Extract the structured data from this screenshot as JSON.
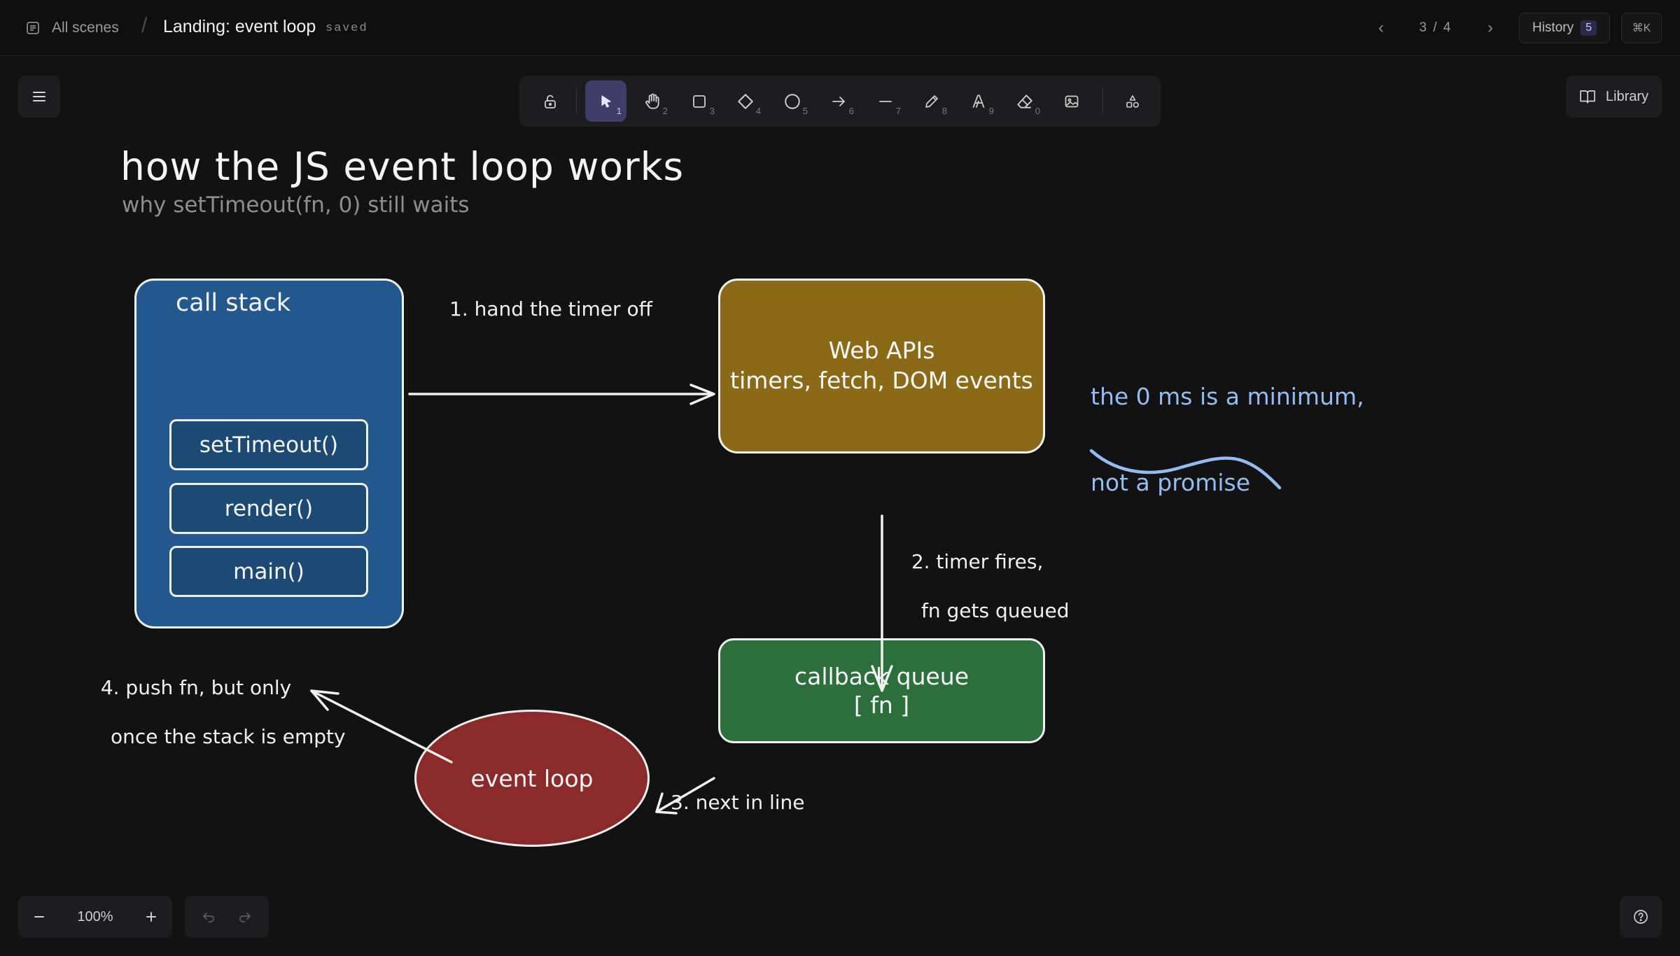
{
  "topbar": {
    "all_scenes": "All scenes",
    "scene_title": "Landing: event loop",
    "save_status": "saved",
    "page_current": "3",
    "page_total": "4",
    "history_label": "History",
    "history_count": "5",
    "shortcut": "⌘K"
  },
  "toolbar": {
    "tools": [
      {
        "name": "lock",
        "icon": "lock-icon",
        "key": ""
      },
      {
        "name": "selection",
        "icon": "pointer-icon",
        "key": "1",
        "active": true
      },
      {
        "name": "hand",
        "icon": "hand-icon",
        "key": "2"
      },
      {
        "name": "rectangle",
        "icon": "square-icon",
        "key": "3"
      },
      {
        "name": "diamond",
        "icon": "diamond-icon",
        "key": "4"
      },
      {
        "name": "ellipse",
        "icon": "circle-icon",
        "key": "5"
      },
      {
        "name": "arrow",
        "icon": "arrow-icon",
        "key": "6"
      },
      {
        "name": "line",
        "icon": "line-icon",
        "key": "7"
      },
      {
        "name": "draw",
        "icon": "pencil-icon",
        "key": "8"
      },
      {
        "name": "text",
        "icon": "text-icon",
        "key": "9"
      },
      {
        "name": "eraser",
        "icon": "eraser-icon",
        "key": "0"
      },
      {
        "name": "image",
        "icon": "image-icon",
        "key": ""
      },
      {
        "name": "more-shapes",
        "icon": "shapes-icon",
        "key": ""
      }
    ]
  },
  "library_label": "Library",
  "zoom": {
    "value": "100%"
  },
  "canvas": {
    "title": "how the JS event loop works",
    "subtitle": "why setTimeout(fn, 0) still waits",
    "call_stack": {
      "label": "call stack",
      "frames": [
        "setTimeout()",
        "render()",
        "main()"
      ],
      "fill": "#23588e"
    },
    "web_apis": {
      "line1": "Web APIs",
      "line2": "timers, fetch, DOM events",
      "fill": "#8a6a16"
    },
    "callback_queue": {
      "line1": "callback queue",
      "line2": "[ fn ]",
      "fill": "#2c6e3c"
    },
    "event_loop": {
      "label": "event loop",
      "fill": "#8b2a2a"
    },
    "arrows": {
      "step1": "1. hand the timer off",
      "step2_line1": "2. timer fires,",
      "step2_line2": "fn gets queued",
      "step3": "3. next in line",
      "step4_line1": "4. push fn, but only",
      "step4_line2": "once the stack is empty"
    },
    "note": {
      "line1": "the 0 ms is a minimum,",
      "line2": "not a promise",
      "color": "#92bdf3"
    }
  }
}
